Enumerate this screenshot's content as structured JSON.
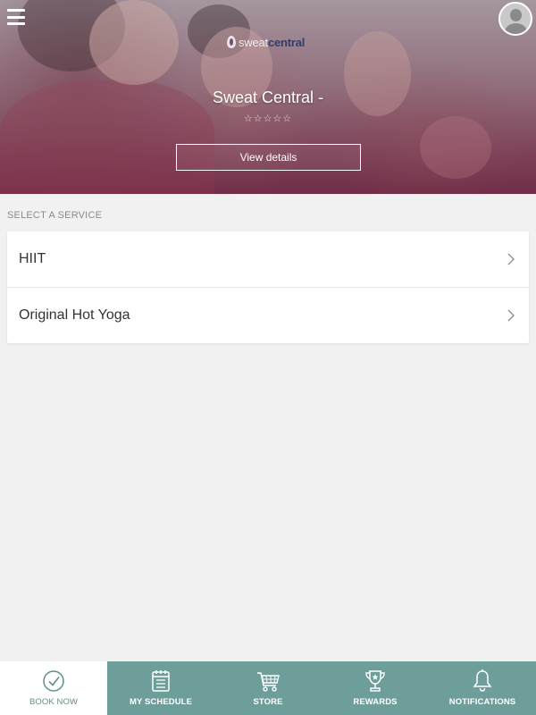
{
  "header": {
    "logo": {
      "text_light": "sweat",
      "text_bold": "central"
    },
    "studio_name": "Sweat Central -",
    "rating_stars": "☆☆☆☆☆",
    "view_details_label": "View details"
  },
  "services": {
    "section_label": "SELECT A SERVICE",
    "items": [
      {
        "label": "HIIT"
      },
      {
        "label": "Original Hot Yoga"
      }
    ]
  },
  "bottom_nav": {
    "items": [
      {
        "label": "BOOK NOW",
        "icon": "check-circle-icon",
        "active": true
      },
      {
        "label": "MY SCHEDULE",
        "icon": "calendar-icon",
        "active": false
      },
      {
        "label": "STORE",
        "icon": "cart-icon",
        "active": false
      },
      {
        "label": "REWARDS",
        "icon": "trophy-icon",
        "active": false
      },
      {
        "label": "NOTIFICATIONS",
        "icon": "bell-icon",
        "active": false
      }
    ]
  },
  "colors": {
    "nav_background": "#6e9e99",
    "nav_active_text": "#5f8f8a",
    "page_background": "#f1f1f1"
  }
}
